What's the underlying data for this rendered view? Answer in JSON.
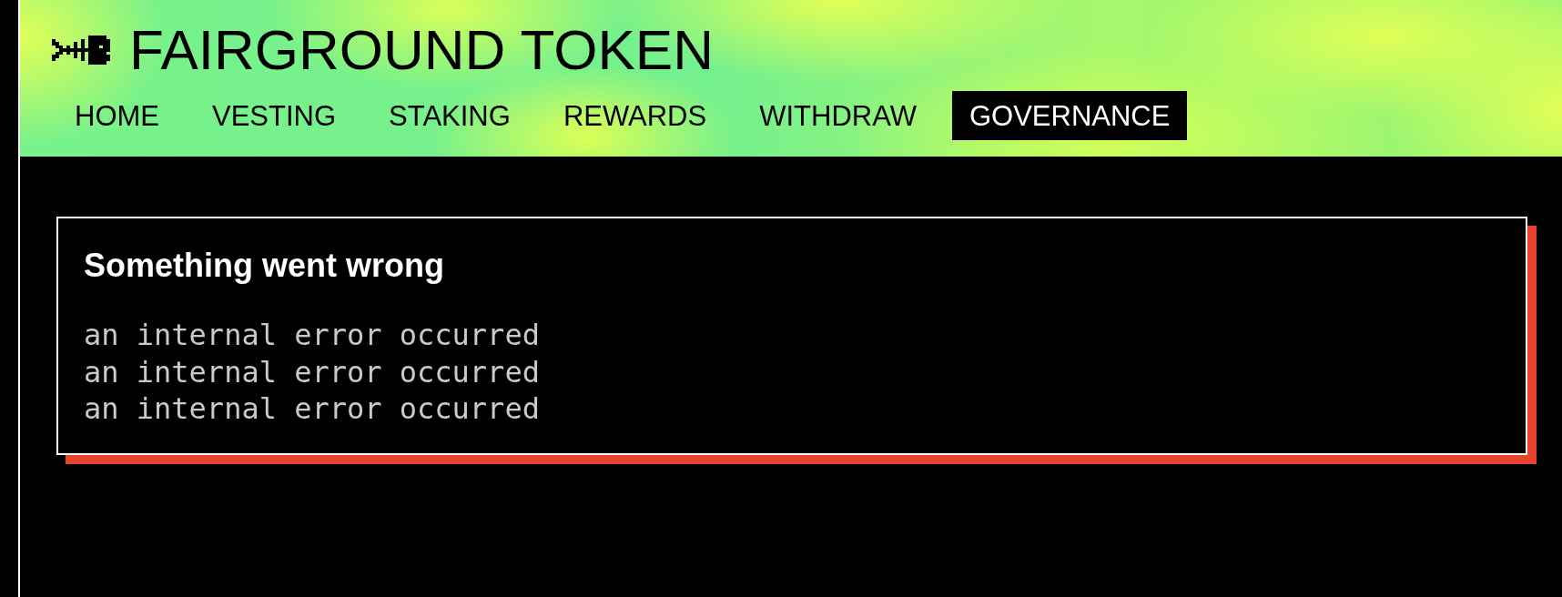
{
  "header": {
    "title": "FAIRGROUND TOKEN"
  },
  "nav": [
    {
      "label": "HOME",
      "selected": false
    },
    {
      "label": "VESTING",
      "selected": false
    },
    {
      "label": "STAKING",
      "selected": false
    },
    {
      "label": "REWARDS",
      "selected": false
    },
    {
      "label": "WITHDRAW",
      "selected": false
    },
    {
      "label": "GOVERNANCE",
      "selected": true
    }
  ],
  "error": {
    "title": "Something went wrong",
    "lines": [
      "an internal error occurred",
      "an internal error occurred",
      "an internal error occurred"
    ]
  }
}
